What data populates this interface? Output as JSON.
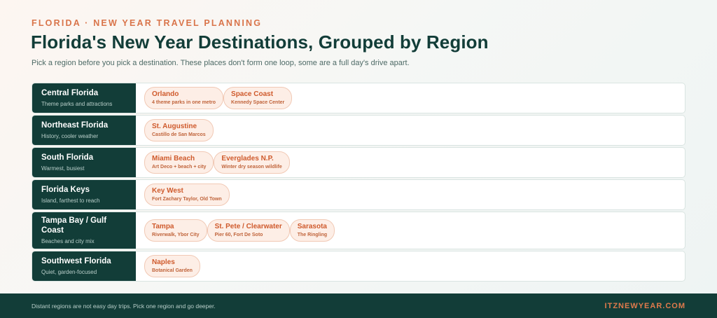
{
  "header": {
    "eyebrow": "FLORIDA · NEW YEAR TRAVEL PLANNING",
    "title": "Florida's New Year Destinations, Grouped by Region",
    "subtitle": "Pick a region before you pick a destination. These places don't form one loop, some are a full day's drive apart."
  },
  "regions": [
    {
      "name": "Central Florida",
      "desc": "Theme parks and attractions",
      "destinations": [
        {
          "name": "Orlando",
          "note": "4 theme parks in one metro"
        },
        {
          "name": "Space Coast",
          "note": "Kennedy Space Center"
        }
      ]
    },
    {
      "name": "Northeast Florida",
      "desc": "History, cooler weather",
      "destinations": [
        {
          "name": "St. Augustine",
          "note": "Castillo de San Marcos"
        }
      ]
    },
    {
      "name": "South Florida",
      "desc": "Warmest, busiest",
      "destinations": [
        {
          "name": "Miami Beach",
          "note": "Art Deco + beach + city"
        },
        {
          "name": "Everglades N.P.",
          "note": "Winter dry season wildlife"
        }
      ]
    },
    {
      "name": "Florida Keys",
      "desc": "Island, farthest to reach",
      "destinations": [
        {
          "name": "Key West",
          "note": "Fort Zachary Taylor, Old Town"
        }
      ]
    },
    {
      "name": "Tampa Bay / Gulf Coast",
      "desc": "Beaches and city mix",
      "destinations": [
        {
          "name": "Tampa",
          "note": "Riverwalk, Ybor City"
        },
        {
          "name": "St. Pete / Clearwater",
          "note": "Pier 60, Fort De Soto"
        },
        {
          "name": "Sarasota",
          "note": "The Ringling"
        }
      ]
    },
    {
      "name": "Southwest Florida",
      "desc": "Quiet, garden-focused",
      "destinations": [
        {
          "name": "Naples",
          "note": "Botanical Garden"
        }
      ]
    }
  ],
  "footer": {
    "note": "Distant regions are not easy day trips. Pick one region and go deeper.",
    "brand": "ITZNEWYEAR.COM"
  }
}
